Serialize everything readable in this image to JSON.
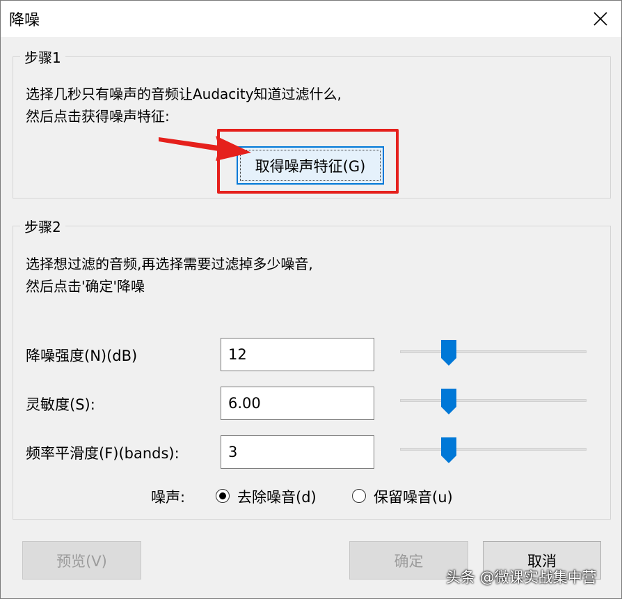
{
  "title": "降噪",
  "step1": {
    "legend": "步骤1",
    "line1": "选择几秒只有噪声的音频让Audacity知道过滤什么,",
    "line2": "然后点击获得噪声特征:",
    "button": "取得噪声特征(G)"
  },
  "step2": {
    "legend": "步骤2",
    "line1": "选择想过滤的音频,再选择需要过滤掉多少噪音,",
    "line2": "然后点击'确定'降噪",
    "rows": [
      {
        "label": "降噪强度(N)(dB)",
        "value": "12",
        "slider_pct": 0.26
      },
      {
        "label": "灵敏度(S):",
        "value": "6.00",
        "slider_pct": 0.26
      },
      {
        "label": "频率平滑度(F)(bands):",
        "value": "3",
        "slider_pct": 0.26
      }
    ],
    "noise_label": "噪声:",
    "option_remove": "去除噪音(d)",
    "option_keep": "保留噪音(u)",
    "selected": "remove"
  },
  "buttons": {
    "preview": "预览(V)",
    "ok": "确定",
    "cancel": "取消"
  },
  "watermark": "头条 @微课实战集中营",
  "colors": {
    "highlight": "#e5201c",
    "focus": "#0078d7",
    "slider": "#0078d7"
  }
}
